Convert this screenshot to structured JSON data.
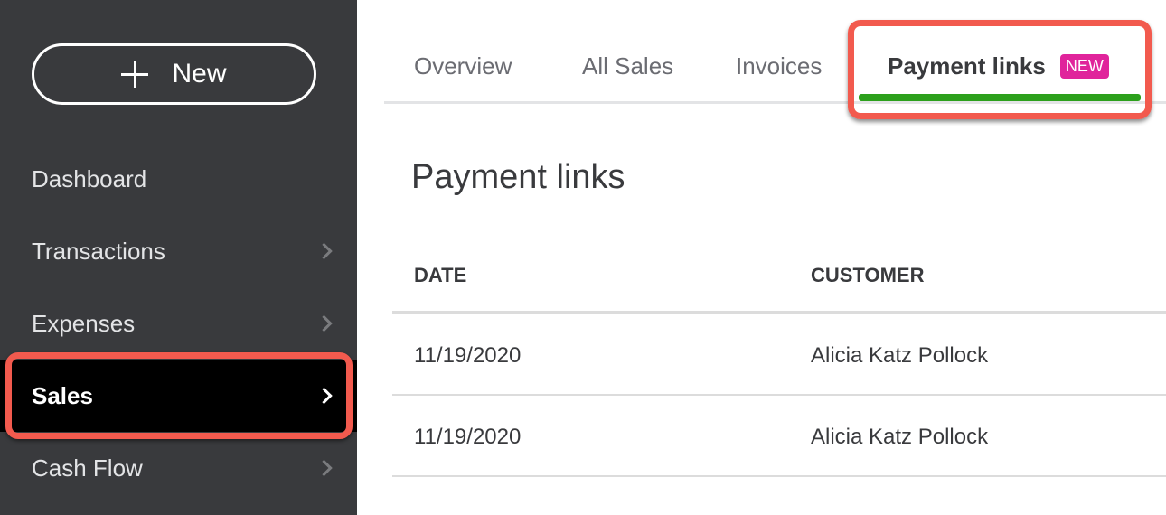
{
  "sidebar": {
    "new_button": {
      "label": "New",
      "icon": "plus-icon"
    },
    "items": [
      {
        "label": "Dashboard",
        "has_chevron": false,
        "active": false
      },
      {
        "label": "Transactions",
        "has_chevron": true,
        "active": false
      },
      {
        "label": "Expenses",
        "has_chevron": true,
        "active": false
      },
      {
        "label": "Sales",
        "has_chevron": true,
        "active": true
      },
      {
        "label": "Cash Flow",
        "has_chevron": true,
        "active": false
      }
    ]
  },
  "tabs": [
    {
      "label": "Overview",
      "active": false
    },
    {
      "label": "All Sales",
      "active": false
    },
    {
      "label": "Invoices",
      "active": false
    },
    {
      "label": "Payment links",
      "active": true,
      "badge": "NEW"
    }
  ],
  "main": {
    "title": "Payment links",
    "table": {
      "columns": [
        "DATE",
        "CUSTOMER"
      ],
      "rows": [
        {
          "date": "11/19/2020",
          "customer": "Alicia Katz Pollock"
        },
        {
          "date": "11/19/2020",
          "customer": "Alicia Katz Pollock"
        }
      ]
    }
  },
  "colors": {
    "sidebar_bg": "#393a3d",
    "active_tab_underline": "#2ca01c",
    "badge_bg": "#e0249b",
    "annotation_highlight": "#f25a4e"
  }
}
